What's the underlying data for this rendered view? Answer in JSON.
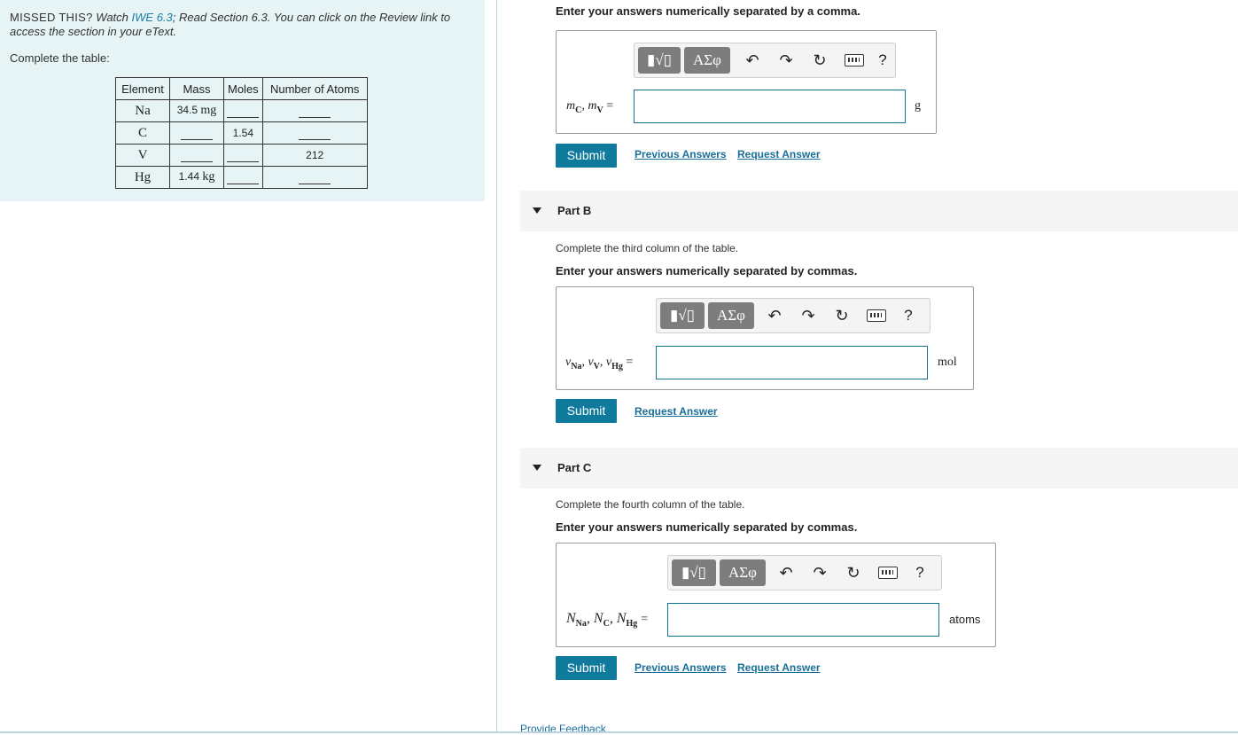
{
  "hint": {
    "missed_label": "MISSED THIS?",
    "watch_text": "Watch",
    "iwe_link": "IWE 6.3",
    "rest_text": "; Read Section 6.3. You can click on the Review link to access the section in your eText."
  },
  "complete_table_label": "Complete the table:",
  "table": {
    "headers": [
      "Element",
      "Mass",
      "Moles",
      "Number of Atoms"
    ],
    "rows": [
      {
        "element": "Na",
        "mass_value": "34.5",
        "mass_unit": "mg",
        "moles": "",
        "atoms": ""
      },
      {
        "element": "C",
        "mass_value": "",
        "mass_unit": "",
        "moles": "1.54",
        "atoms": ""
      },
      {
        "element": "V",
        "mass_value": "",
        "mass_unit": "",
        "moles": "",
        "atoms": "212"
      },
      {
        "element": "Hg",
        "mass_value": "1.44",
        "mass_unit": "kg",
        "moles": "",
        "atoms": ""
      }
    ]
  },
  "part_a": {
    "prompt": "Enter your answers numerically separated by a comma.",
    "label_1": "m",
    "sub_1": "C",
    "label_2": "m",
    "sub_2": "V",
    "equals": "=",
    "unit": "g",
    "submit": "Submit",
    "previous": "Previous Answers",
    "request": "Request Answer"
  },
  "part_b": {
    "title": "Part B",
    "instruction": "Complete the third column of the table.",
    "prompt": "Enter your answers numerically separated by commas.",
    "label_1": "ν",
    "sub_1": "Na",
    "label_2": "ν",
    "sub_2": "V",
    "label_3": "ν",
    "sub_3": "Hg",
    "equals": "=",
    "unit": "mol",
    "submit": "Submit",
    "request": "Request Answer"
  },
  "part_c": {
    "title": "Part C",
    "instruction": "Complete the fourth column of the table.",
    "prompt": "Enter your answers numerically separated by commas.",
    "label_1": "N",
    "sub_1": "Na",
    "label_2": "N",
    "sub_2": "C",
    "label_3": "N",
    "sub_3": "Hg",
    "equals": "=",
    "unit": "atoms",
    "submit": "Submit",
    "previous": "Previous Answers",
    "request": "Request Answer"
  },
  "toolbar": {
    "template_btn": "▮√▯",
    "greek_btn": "ΑΣφ",
    "undo_icon": "undo-icon",
    "redo_icon": "redo-icon",
    "reset_icon": "reset-icon",
    "keyboard_icon": "keyboard-icon",
    "help": "?"
  },
  "feedback": "Provide Feedback"
}
